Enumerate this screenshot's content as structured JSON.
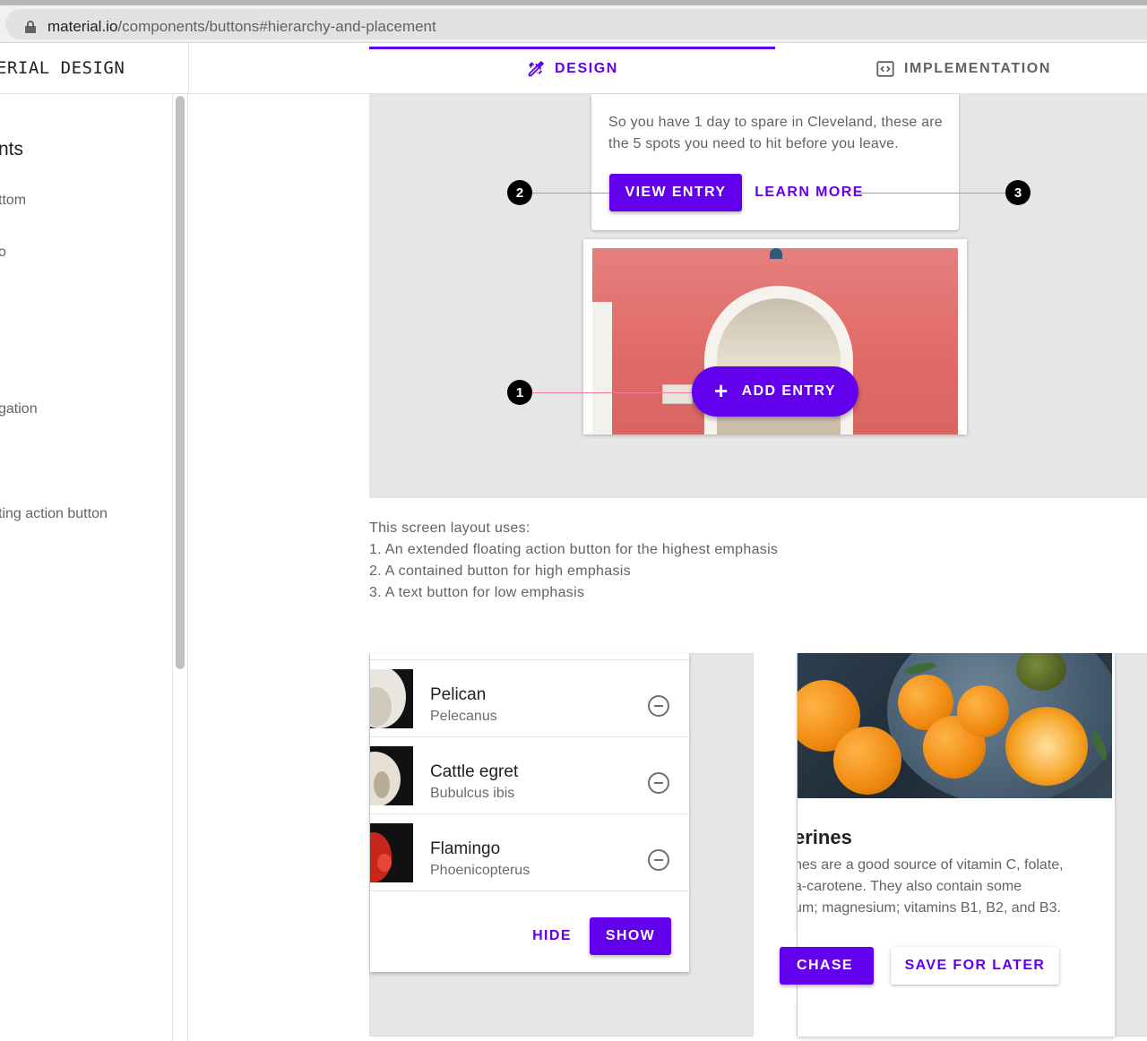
{
  "browser": {
    "url_host": "material.io",
    "url_path": "/components/buttons#hierarchy-and-placement"
  },
  "header": {
    "brand": "ERIAL DESIGN",
    "tabs": [
      {
        "label": "DESIGN",
        "icon": "design-tools-icon",
        "active": true
      },
      {
        "label": "IMPLEMENTATION",
        "icon": "code-icon",
        "active": false
      }
    ],
    "accent_color": "#6200ee"
  },
  "sidebar": {
    "heading": "nts",
    "items": [
      "ttom",
      "o",
      "gation",
      "ting action button"
    ]
  },
  "demo1": {
    "card_text": "So you have 1 day to spare in Cleveland, these are the 5 spots you need to hit before you leave.",
    "view_entry": "VIEW ENTRY",
    "learn_more": "LEARN MORE",
    "fab_label": "ADD ENTRY",
    "callouts": [
      "1",
      "2",
      "3"
    ]
  },
  "description": {
    "lines": [
      "This screen layout uses:",
      "1. An extended floating action button for the highest emphasis",
      "2. A contained button for high emphasis",
      "3. A text button for low emphasis"
    ]
  },
  "demo2": {
    "rows": [
      {
        "title": "Pelican",
        "subtitle": "Pelecanus"
      },
      {
        "title": "Cattle egret",
        "subtitle": "Bubulcus ibis"
      },
      {
        "title": "Flamingo",
        "subtitle": "Phoenicopterus"
      }
    ],
    "hide": "HIDE",
    "show": "SHOW"
  },
  "demo3": {
    "title": "erines",
    "body": [
      "nes are a good source of vitamin C, folate,",
      "a-carotene. They also contain some",
      "um; magnesium; vitamins B1, B2, and B3."
    ],
    "purchase": "CHASE",
    "save_for_later": "SAVE FOR LATER"
  }
}
